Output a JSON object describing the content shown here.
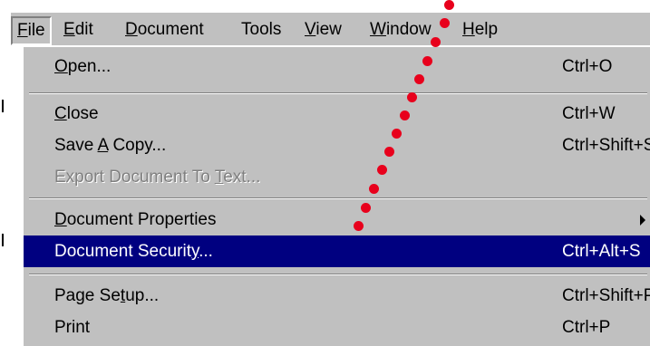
{
  "menubar": {
    "items": [
      {
        "pre": "",
        "u": "F",
        "post": "ile"
      },
      {
        "pre": "",
        "u": "E",
        "post": "dit"
      },
      {
        "pre": "",
        "u": "D",
        "post": "ocument"
      },
      {
        "pre": "Tools",
        "u": "",
        "post": ""
      },
      {
        "pre": "",
        "u": "V",
        "post": "iew"
      },
      {
        "pre": "",
        "u": "W",
        "post": "indow"
      },
      {
        "pre": "",
        "u": "H",
        "post": "elp"
      }
    ]
  },
  "file_menu": {
    "open": {
      "pre": "",
      "u": "O",
      "post": "pen...",
      "shortcut": "Ctrl+O"
    },
    "close": {
      "pre": "",
      "u": "C",
      "post": "lose",
      "shortcut": "Ctrl+W"
    },
    "save_copy": {
      "pre": "Save ",
      "u": "A",
      "post": " Copy...",
      "shortcut": "Ctrl+Shift+S"
    },
    "export": {
      "pre": "Export Document To ",
      "u": "T",
      "post": "ext...",
      "shortcut": ""
    },
    "properties": {
      "pre": "",
      "u": "D",
      "post": "ocument Properties",
      "shortcut": ""
    },
    "security": {
      "pre": "Document Securit",
      "u": "y",
      "post": "...",
      "shortcut": "Ctrl+Alt+S"
    },
    "page_setup": {
      "pre": "Page Se",
      "u": "t",
      "post": "up...",
      "shortcut": "Ctrl+Shift+P"
    },
    "print": {
      "pre": "Print",
      "u": "",
      "post": "",
      "shortcut": "Ctrl+P"
    }
  },
  "colors": {
    "menu_bg": "#c0c0c0",
    "highlight_bg": "#000080",
    "highlight_text": "#ffffff",
    "disabled_text": "#808080",
    "annotation_dots": "#e8001c"
  }
}
